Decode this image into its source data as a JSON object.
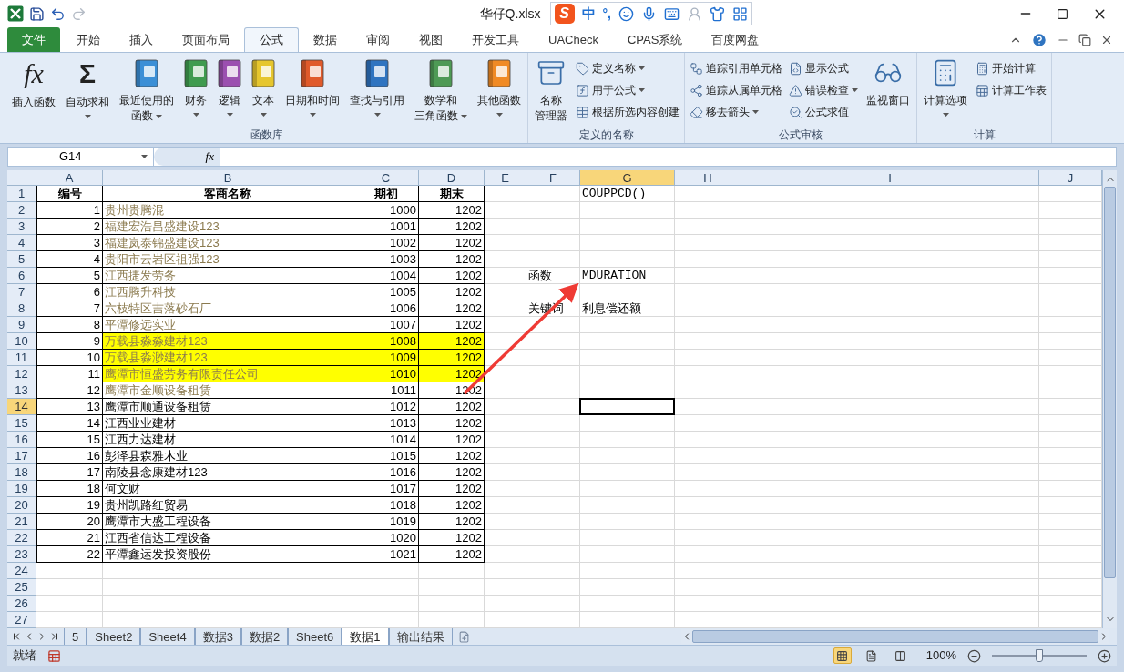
{
  "window": {
    "title": "华仔Q.xlsx"
  },
  "ime_bar": {
    "logo": "S",
    "mode": "中",
    "punctuation": "°,"
  },
  "ribbon_tabs": [
    {
      "label": "文件",
      "kind": "file",
      "selected": false
    },
    {
      "label": "开始",
      "kind": "tab",
      "selected": false
    },
    {
      "label": "插入",
      "kind": "tab",
      "selected": false
    },
    {
      "label": "页面布局",
      "kind": "tab",
      "selected": false
    },
    {
      "label": "公式",
      "kind": "tab",
      "selected": true
    },
    {
      "label": "数据",
      "kind": "tab",
      "selected": false
    },
    {
      "label": "审阅",
      "kind": "tab",
      "selected": false
    },
    {
      "label": "视图",
      "kind": "tab",
      "selected": false
    },
    {
      "label": "开发工具",
      "kind": "tab",
      "selected": false
    },
    {
      "label": "UACheck",
      "kind": "tab",
      "selected": false
    },
    {
      "label": "CPAS系统",
      "kind": "tab",
      "selected": false
    },
    {
      "label": "百度网盘",
      "kind": "tab",
      "selected": false
    }
  ],
  "ribbon_groups": [
    {
      "label": "函数库",
      "items": [
        {
          "kind": "large",
          "glyph": "fx",
          "lines": [
            "插入函数"
          ],
          "dropdown": false
        },
        {
          "kind": "large",
          "glyph": "Σ",
          "lines": [
            "自动求和"
          ],
          "dropdown": true
        },
        {
          "kind": "large",
          "lines": [
            "最近使用的",
            "函数"
          ],
          "dropdown": true
        },
        {
          "kind": "large",
          "lines": [
            "财务"
          ],
          "dropdown": true
        },
        {
          "kind": "large",
          "lines": [
            "逻辑"
          ],
          "dropdown": true
        },
        {
          "kind": "large",
          "lines": [
            "文本"
          ],
          "dropdown": true
        },
        {
          "kind": "large",
          "lines": [
            "日期和时间"
          ],
          "dropdown": true
        },
        {
          "kind": "large",
          "lines": [
            "查找与引用"
          ],
          "dropdown": true
        },
        {
          "kind": "large",
          "lines": [
            "数学和",
            "三角函数"
          ],
          "dropdown": true
        },
        {
          "kind": "large",
          "lines": [
            "其他函数"
          ],
          "dropdown": true
        }
      ]
    },
    {
      "label": "定义的名称",
      "items": [
        {
          "kind": "large",
          "lines": [
            "名称",
            "管理器"
          ],
          "dropdown": false
        },
        {
          "kind": "small",
          "lines": [
            "定义名称"
          ],
          "dropdown": true
        },
        {
          "kind": "small",
          "lines": [
            "用于公式"
          ],
          "dropdown": true
        },
        {
          "kind": "small",
          "lines": [
            "根据所选内容创建"
          ],
          "dropdown": false
        }
      ]
    },
    {
      "label": "公式审核",
      "items": [
        {
          "kind": "small",
          "lines": [
            "追踪引用单元格"
          ],
          "dropdown": false
        },
        {
          "kind": "small",
          "lines": [
            "追踪从属单元格"
          ],
          "dropdown": false
        },
        {
          "kind": "small",
          "lines": [
            "移去箭头"
          ],
          "dropdown": true
        },
        {
          "kind": "small",
          "lines": [
            "显示公式"
          ],
          "dropdown": false
        },
        {
          "kind": "small",
          "lines": [
            "错误检查"
          ],
          "dropdown": true
        },
        {
          "kind": "small",
          "lines": [
            "公式求值"
          ],
          "dropdown": false
        },
        {
          "kind": "large",
          "lines": [
            "监视窗口"
          ],
          "dropdown": false
        }
      ]
    },
    {
      "label": "计算",
      "items": [
        {
          "kind": "large",
          "lines": [
            "计算选项"
          ],
          "dropdown": true
        },
        {
          "kind": "small",
          "lines": [
            "开始计算"
          ],
          "dropdown": false
        },
        {
          "kind": "small",
          "lines": [
            "计算工作表"
          ],
          "dropdown": false
        }
      ]
    }
  ],
  "formula_bar": {
    "name_box": "G14",
    "fx_glyph": "fx"
  },
  "columns": [
    {
      "label": "A",
      "selected": false
    },
    {
      "label": "B",
      "selected": false
    },
    {
      "label": "C",
      "selected": false
    },
    {
      "label": "D",
      "selected": false
    },
    {
      "label": "E",
      "selected": false
    },
    {
      "label": "F",
      "selected": false
    },
    {
      "label": "G",
      "selected": true
    },
    {
      "label": "H",
      "selected": false
    },
    {
      "label": "I",
      "selected": false
    },
    {
      "label": "J",
      "selected": false
    }
  ],
  "row_headers": [
    {
      "label": "1",
      "selected": false
    },
    {
      "label": "2",
      "selected": false
    },
    {
      "label": "3",
      "selected": false
    },
    {
      "label": "4",
      "selected": false
    },
    {
      "label": "5",
      "selected": false
    },
    {
      "label": "6",
      "selected": false
    },
    {
      "label": "7",
      "selected": false
    },
    {
      "label": "8",
      "selected": false
    },
    {
      "label": "9",
      "selected": false
    },
    {
      "label": "10",
      "selected": false
    },
    {
      "label": "11",
      "selected": false
    },
    {
      "label": "12",
      "selected": false
    },
    {
      "label": "13",
      "selected": false
    },
    {
      "label": "14",
      "selected": true
    },
    {
      "label": "15",
      "selected": false
    },
    {
      "label": "16",
      "selected": false
    },
    {
      "label": "17",
      "selected": false
    },
    {
      "label": "18",
      "selected": false
    },
    {
      "label": "19",
      "selected": false
    },
    {
      "label": "20",
      "selected": false
    },
    {
      "label": "21",
      "selected": false
    },
    {
      "label": "22",
      "selected": false
    },
    {
      "label": "23",
      "selected": false
    },
    {
      "label": "24",
      "selected": false
    },
    {
      "label": "25",
      "selected": false
    },
    {
      "label": "26",
      "selected": false
    },
    {
      "label": "27",
      "selected": false
    }
  ],
  "table": {
    "headers": [
      "编号",
      "客商名称",
      "期初",
      "期末"
    ],
    "rows": [
      {
        "no": "1",
        "name": "贵州贵腾混",
        "start": "1000",
        "end": "1202",
        "color": "#8b7a4e",
        "highlighted": false
      },
      {
        "no": "2",
        "name": "福建宏浩昌盛建设123",
        "start": "1001",
        "end": "1202",
        "color": "#8b7a4e",
        "highlighted": false
      },
      {
        "no": "3",
        "name": "福建岚泰锦盛建设123",
        "start": "1002",
        "end": "1202",
        "color": "#8b7a4e",
        "highlighted": false
      },
      {
        "no": "4",
        "name": "贵阳市云岩区祖强123",
        "start": "1003",
        "end": "1202",
        "color": "#8b7a4e",
        "highlighted": false
      },
      {
        "no": "5",
        "name": "江西捷发劳务",
        "start": "1004",
        "end": "1202",
        "color": "#8b7a4e",
        "highlighted": false
      },
      {
        "no": "6",
        "name": "江西腾升科技",
        "start": "1005",
        "end": "1202",
        "color": "#8b7a4e",
        "highlighted": false
      },
      {
        "no": "7",
        "name": "六枝特区吉落砂石厂",
        "start": "1006",
        "end": "1202",
        "color": "#8b7a4e",
        "highlighted": false
      },
      {
        "no": "8",
        "name": "平潭修远实业",
        "start": "1007",
        "end": "1202",
        "color": "#8b7a4e",
        "highlighted": false
      },
      {
        "no": "9",
        "name": "万载县淼淼建材123",
        "start": "1008",
        "end": "1202",
        "color": "#8b7a4e",
        "highlighted": true
      },
      {
        "no": "10",
        "name": "万载县淼渺建材123",
        "start": "1009",
        "end": "1202",
        "color": "#8b7a4e",
        "highlighted": true
      },
      {
        "no": "11",
        "name": "鹰潭市恒盛劳务有限责任公司",
        "start": "1010",
        "end": "1202",
        "color": "#8b7a4e",
        "highlighted": true
      },
      {
        "no": "12",
        "name": "鹰潭市金顺设备租赁",
        "start": "1011",
        "end": "1202",
        "color": "#8b7a4e",
        "highlighted": false
      },
      {
        "no": "13",
        "name": "鹰潭市顺通设备租赁",
        "start": "1012",
        "end": "1202",
        "color": "#000000",
        "highlighted": false
      },
      {
        "no": "14",
        "name": "江西业业建材",
        "start": "1013",
        "end": "1202",
        "color": "#000000",
        "highlighted": false
      },
      {
        "no": "15",
        "name": "江西力达建材",
        "start": "1014",
        "end": "1202",
        "color": "#000000",
        "highlighted": false
      },
      {
        "no": "16",
        "name": "彭泽县森雅木业",
        "start": "1015",
        "end": "1202",
        "color": "#000000",
        "highlighted": false
      },
      {
        "no": "17",
        "name": "南陵县念康建材123",
        "start": "1016",
        "end": "1202",
        "color": "#000000",
        "highlighted": false
      },
      {
        "no": "18",
        "name": "何文财",
        "start": "1017",
        "end": "1202",
        "color": "#000000",
        "highlighted": false
      },
      {
        "no": "19",
        "name": "贵州凯路红贸易",
        "start": "1018",
        "end": "1202",
        "color": "#000000",
        "highlighted": false
      },
      {
        "no": "20",
        "name": "鹰潭市大盛工程设备",
        "start": "1019",
        "end": "1202",
        "color": "#000000",
        "highlighted": false
      },
      {
        "no": "21",
        "name": "江西省信达工程设备",
        "start": "1020",
        "end": "1202",
        "color": "#000000",
        "highlighted": false
      },
      {
        "no": "22",
        "name": "平潭鑫运发投资股份",
        "start": "1021",
        "end": "1202",
        "color": "#000000",
        "highlighted": false
      }
    ]
  },
  "cell_G1": "COUPPCD()",
  "cell_F6": "函数",
  "cell_G6": "MDURATION",
  "cell_F8": "关键词",
  "cell_G8": "利息偿还额",
  "sheet_tabs": [
    {
      "label": "5",
      "selected": false
    },
    {
      "label": "Sheet2",
      "selected": false
    },
    {
      "label": "Sheet4",
      "selected": false
    },
    {
      "label": "数据3",
      "selected": false
    },
    {
      "label": "数据2",
      "selected": false
    },
    {
      "label": "Sheet6",
      "selected": false
    },
    {
      "label": "数据1",
      "selected": true
    },
    {
      "label": "输出结果",
      "selected": false
    }
  ],
  "status_bar": {
    "status": "就绪",
    "view_buttons": [
      {
        "selected": true
      },
      {
        "selected": false
      },
      {
        "selected": false
      }
    ],
    "zoom": "100%",
    "zoom_slider": {
      "level": 0.5
    }
  }
}
